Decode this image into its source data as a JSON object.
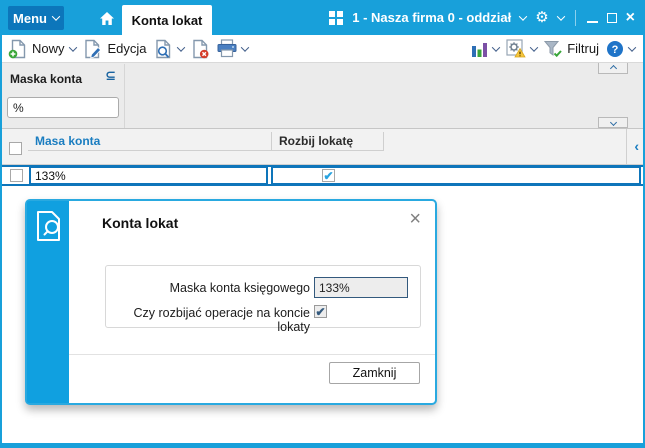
{
  "titlebar": {
    "menu_label": "Menu",
    "tab_label": "Konta lokat",
    "company_label": "1 - Nasza firma 0 - oddział"
  },
  "toolbar": {
    "new_label": "Nowy",
    "edit_label": "Edycja",
    "filter_label": "Filtruj"
  },
  "filter_panel": {
    "label": "Maska konta",
    "value": "%"
  },
  "grid": {
    "columns": [
      {
        "label": "Masa konta"
      },
      {
        "label": "Rozbij lokatę"
      }
    ],
    "row": {
      "maska": "133%",
      "rozbij": true
    }
  },
  "dialog": {
    "title": "Konta lokat",
    "maska_label": "Maska konta księgowego",
    "maska_value": "133%",
    "rozbij_label": "Czy rozbijać operacje na koncie lokaty",
    "rozbij_checked": true,
    "close_label": "Zamknij"
  },
  "icons": {
    "check_glyph": "✔",
    "operator_glyph": "⊆",
    "close_glyph": "×",
    "gear_glyph": "⚙",
    "chevron_left_glyph": "‹"
  },
  "colors": {
    "titlebar": "#18a0da",
    "menu_button": "#0c76bb",
    "edit_border": "#0e75ba",
    "check_cyan": "#29a3e0",
    "dialog_border": "#29a9e0",
    "dialog_strip": "#10a0e0",
    "navy": "#33597d",
    "sorted_column": "#1a7dc0"
  }
}
